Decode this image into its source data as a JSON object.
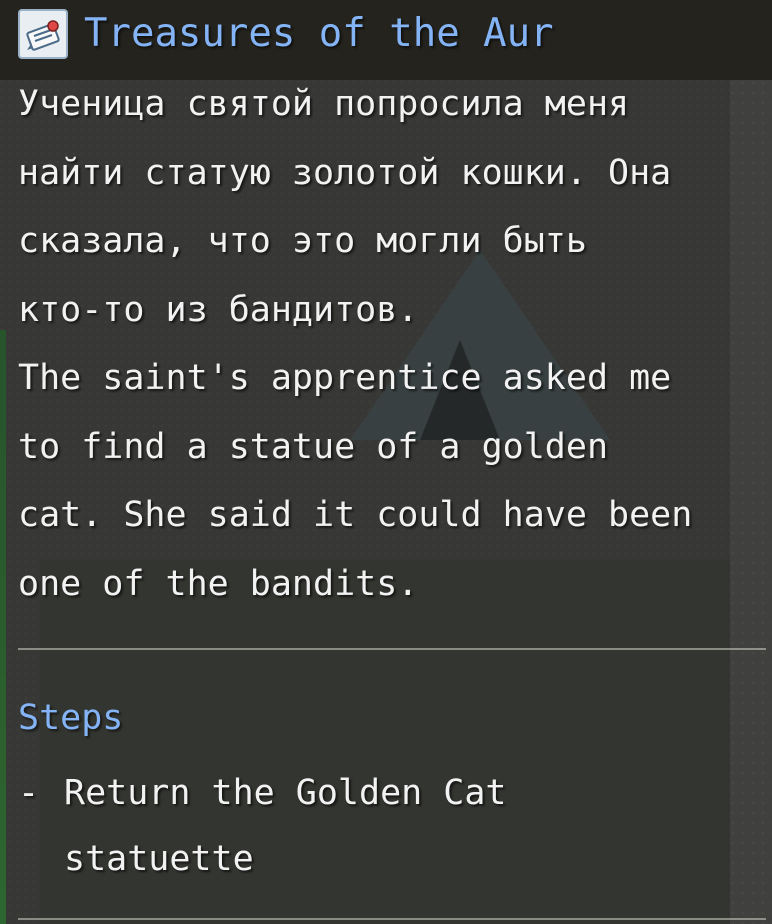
{
  "quest": {
    "icon": "quest-scroll-icon",
    "title": "Treasures of the Aur",
    "description_lines": [
      "Ученица святой попросила меня",
      "найти статую золотой кошки. Она",
      "сказала, что это могли быть",
      "кто-то из бандитов.",
      "The saint's apprentice asked me",
      "to find a statue of a golden",
      "cat. She said it could have been",
      "one of the bandits."
    ]
  },
  "steps": {
    "heading": "Steps",
    "items": [
      {
        "bullet": "-",
        "lines": [
          "Return the Golden Cat",
          "statuette"
        ]
      }
    ]
  },
  "colors": {
    "heading": "#84b4f6",
    "text": "#f2f2f2",
    "divider": "#d2d2c8"
  }
}
